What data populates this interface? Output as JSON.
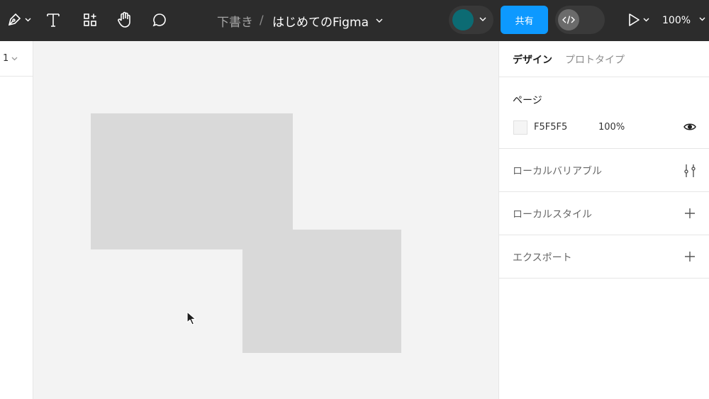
{
  "toolbar": {
    "tools": [
      {
        "name": "pen-tool",
        "icon": "pen-icon"
      },
      {
        "name": "text-tool",
        "icon": "text-icon"
      },
      {
        "name": "resources-tool",
        "icon": "resources-icon"
      },
      {
        "name": "hand-tool",
        "icon": "hand-icon"
      },
      {
        "name": "comment-tool",
        "icon": "comment-icon"
      }
    ],
    "breadcrumb": {
      "project": "下書き",
      "separator": "/",
      "file": "はじめてのFigma"
    },
    "share_label": "共有",
    "zoom_label": "100%",
    "avatar_color": "#0c6b73",
    "accent_color": "#0d99ff"
  },
  "left_panel": {
    "page_label": "1"
  },
  "right_panel": {
    "tabs": [
      {
        "label": "デザイン",
        "active": true
      },
      {
        "label": "プロトタイプ",
        "active": false
      }
    ],
    "page_section": {
      "title": "ページ",
      "fill_hex": "F5F5F5",
      "fill_opacity": "100%",
      "fill_color": "#f5f5f5"
    },
    "local_variables": {
      "title": "ローカルバリアブル"
    },
    "local_styles": {
      "title": "ローカルスタイル"
    },
    "export": {
      "title": "エクスポート"
    }
  },
  "canvas": {
    "background": "#f3f3f3",
    "shape_fill": "#d9d9d9"
  }
}
